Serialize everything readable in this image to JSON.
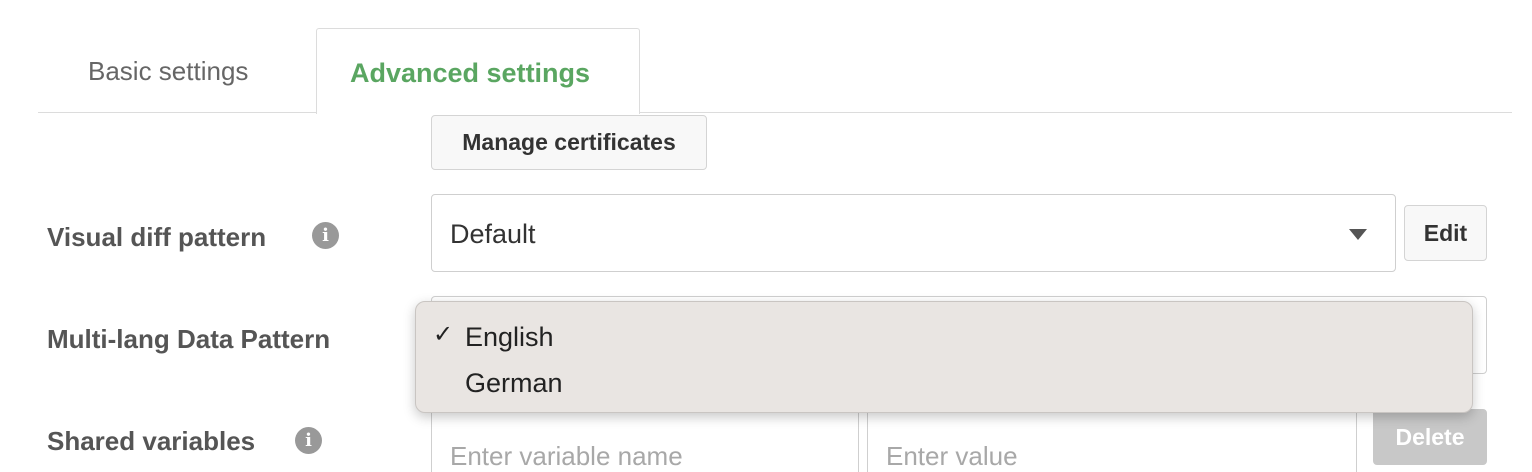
{
  "tabs": {
    "basic_label": "Basic settings",
    "advanced_label": "Advanced settings",
    "active": "Advanced settings",
    "active_color": "#5aa661"
  },
  "certificates": {
    "button_label": "Manage certificates"
  },
  "visual_diff": {
    "label": "Visual diff pattern",
    "info_icon": "info-icon",
    "selected": "Default",
    "edit_label": "Edit"
  },
  "multi_lang": {
    "label": "Multi-lang Data Pattern",
    "options": [
      {
        "label": "English",
        "checked": "✓"
      },
      {
        "label": "German",
        "checked": ""
      }
    ]
  },
  "shared_variables": {
    "label": "Shared variables",
    "info_icon": "info-icon",
    "name_placeholder": "Enter variable name",
    "value_placeholder": "Enter value",
    "delete_label": "Delete"
  }
}
